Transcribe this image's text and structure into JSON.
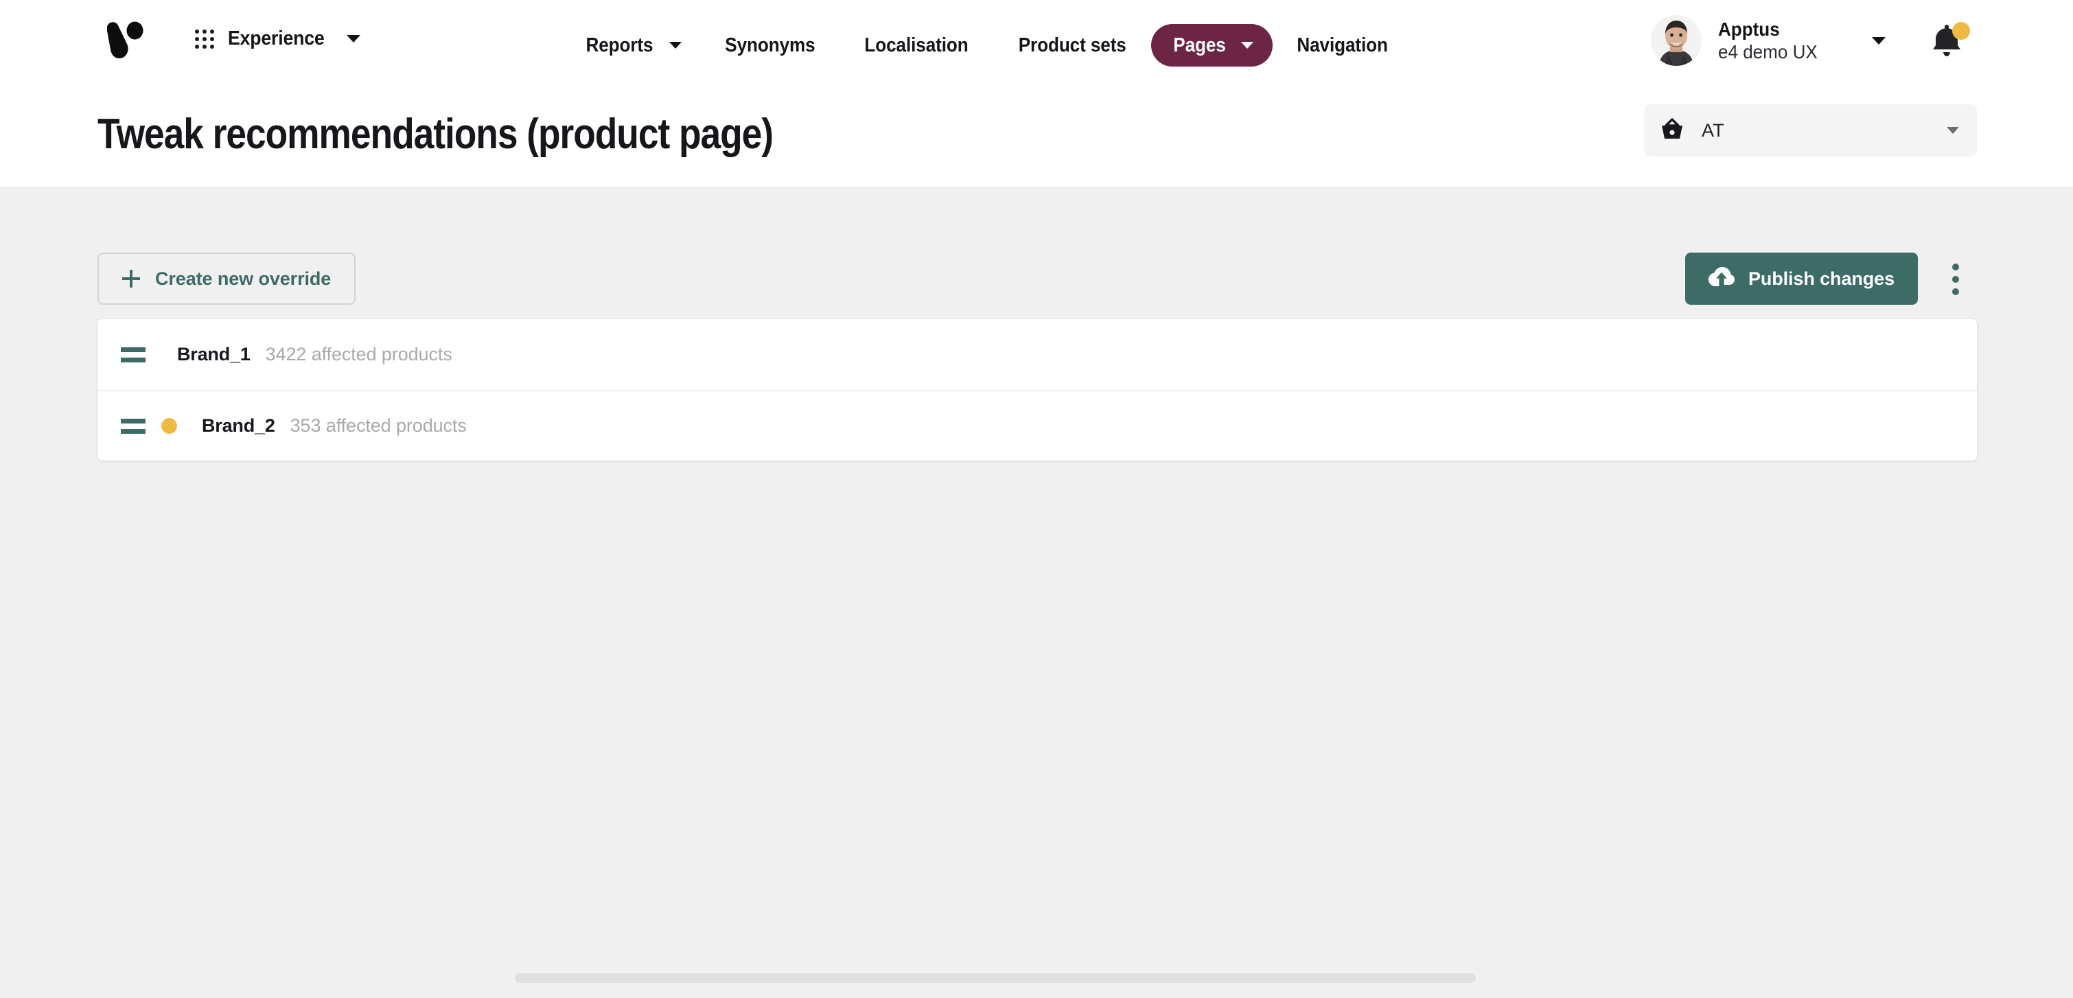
{
  "brand": {
    "logo_icon": "voyado-logo-icon"
  },
  "topbar": {
    "app_switcher": {
      "grid_icon": "grid-apps-icon",
      "label": "Experience",
      "caret_icon": "chevron-down-icon"
    },
    "nav": [
      {
        "label": "Reports",
        "has_caret": true,
        "active": false
      },
      {
        "label": "Synonyms",
        "has_caret": false,
        "active": false
      },
      {
        "label": "Localisation",
        "has_caret": false,
        "active": false
      },
      {
        "label": "Product sets",
        "has_caret": false,
        "active": false
      },
      {
        "label": "Pages",
        "has_caret": true,
        "active": true
      },
      {
        "label": "Navigation",
        "has_caret": false,
        "active": false
      }
    ],
    "profile": {
      "avatar_icon": "user-avatar-photo",
      "name": "Apptus",
      "subtitle": "e4 demo UX",
      "caret_icon": "chevron-down-icon"
    },
    "notifications": {
      "bell_icon": "bell-icon",
      "has_unread_badge": true,
      "badge_color": "#f0b942"
    }
  },
  "header": {
    "title": "Tweak recommendations (product page)",
    "market_select": {
      "icon": "shopping-basket-icon",
      "value": "AT",
      "caret_icon": "chevron-down-icon"
    }
  },
  "actions": {
    "create_override": {
      "icon": "plus-icon",
      "label": "Create new override"
    },
    "publish": {
      "icon": "cloud-upload-icon",
      "label": "Publish changes"
    },
    "more_menu_icon": "kebab-menu-icon"
  },
  "overrides": {
    "rows": [
      {
        "drag_icon": "drag-handle-icon",
        "has_status_dot": false,
        "name": "Brand_1",
        "meta": "3422 affected products"
      },
      {
        "drag_icon": "drag-handle-icon",
        "has_status_dot": true,
        "status_color": "#f0b942",
        "name": "Brand_2",
        "meta": "353 affected products"
      }
    ]
  },
  "colors": {
    "accent_teal": "#3d6b66",
    "active_nav_maroon": "#6d2546",
    "status_amber": "#f0b942",
    "page_background": "#f0f0f0",
    "surface": "#ffffff"
  }
}
